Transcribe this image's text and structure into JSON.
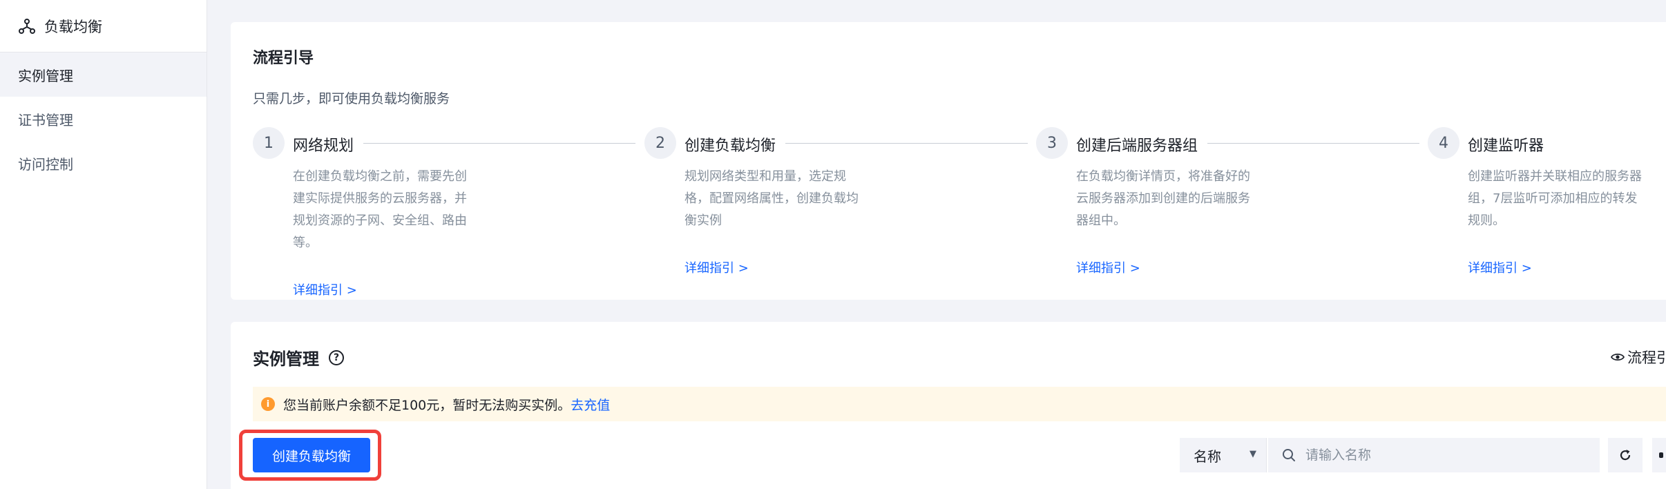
{
  "sidebar": {
    "title": "负载均衡",
    "items": [
      {
        "label": "实例管理",
        "active": true
      },
      {
        "label": "证书管理",
        "active": false
      },
      {
        "label": "访问控制",
        "active": false
      }
    ]
  },
  "guide": {
    "title": "流程引导",
    "subtitle": "只需几步，即可使用负载均衡服务",
    "steps": [
      {
        "num": "1",
        "title": "网络规划",
        "desc": "在创建负载均衡之前，需要先创建实际提供服务的云服务器，并规划资源的子网、安全组、路由等。",
        "link": "详细指引 >"
      },
      {
        "num": "2",
        "title": "创建负载均衡",
        "desc": "规划网络类型和用量，选定规格，配置网络属性，创建负载均衡实例",
        "link": "详细指引 >"
      },
      {
        "num": "3",
        "title": "创建后端服务器组",
        "desc": "在负载均衡详情页，将准备好的云服务器添加到创建的后端服务器组中。",
        "link": "详细指引 >"
      },
      {
        "num": "4",
        "title": "创建监听器",
        "desc": "创建监听器并关联相应的服务器组，7层监听可添加相应的转发规则。",
        "link": "详细指引 >"
      }
    ]
  },
  "instances": {
    "title": "实例管理",
    "guide_toggle": "流程引",
    "notice_text": "您当前账户余额不足100元，暂时无法购买实例。",
    "notice_link": "去充值",
    "create_button": "创建负载均衡",
    "filter_field": "名称",
    "search_placeholder": "请输入名称"
  },
  "colors": {
    "accent": "#1664ff",
    "warning": "#ff9a2e",
    "highlight": "#f0403a"
  }
}
